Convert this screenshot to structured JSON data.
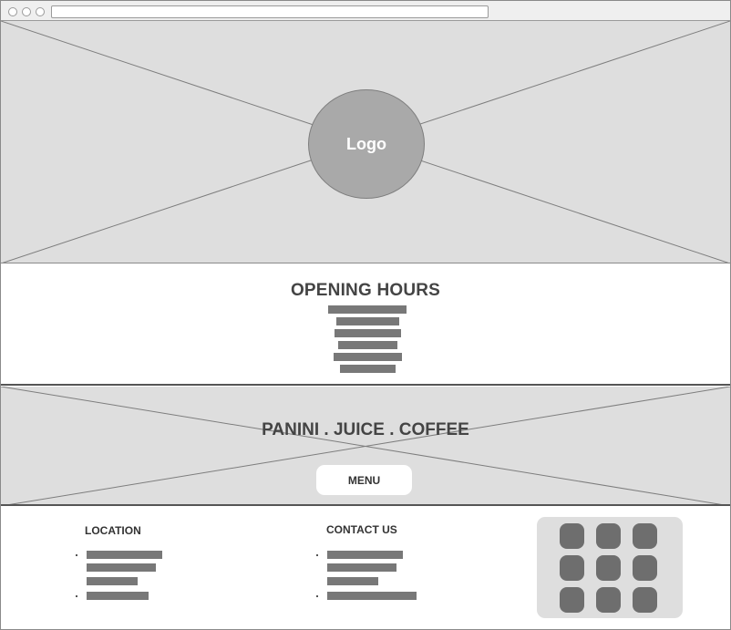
{
  "hero": {
    "logo_label": "Logo"
  },
  "hours": {
    "title": "OPENING HOURS",
    "line_count": 6
  },
  "banner": {
    "tagline": "PANINI . JUICE . COFFEE",
    "menu_label": "MENU"
  },
  "footer": {
    "location": {
      "title": "LOCATION",
      "line_count": 4
    },
    "contact": {
      "title": "CONTACT US",
      "line_count": 4
    },
    "social": {
      "icon_count": 9,
      "icon_name": "social-icon"
    }
  },
  "colors": {
    "placeholder": "#dedede",
    "logo": "#a9a9a9",
    "text_line": "#787878",
    "icon": "#6e6e6e"
  }
}
